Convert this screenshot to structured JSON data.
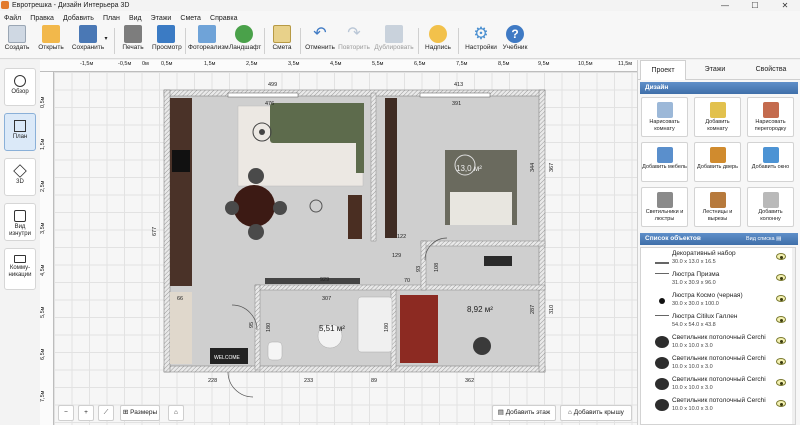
{
  "window": {
    "title": "Евротрешка - Дизайн Интерьера 3D",
    "minimize": "—",
    "maximize": "☐",
    "close": "✕"
  },
  "menu": [
    "Файл",
    "Правка",
    "Добавить",
    "План",
    "Вид",
    "Этажи",
    "Смета",
    "Справка"
  ],
  "toolbar": [
    {
      "label": "Создать",
      "icon": "new-file-icon",
      "color": "#cfd8e3"
    },
    {
      "label": "Открыть",
      "icon": "open-folder-icon",
      "color": "#f2b84b"
    },
    {
      "label": "Сохранить",
      "icon": "save-icon",
      "color": "#4a78b5"
    },
    {
      "label": "Печать",
      "icon": "printer-icon",
      "color": "#7d7d7d"
    },
    {
      "label": "Просмотр",
      "icon": "monitor-icon",
      "color": "#3b7bc4"
    },
    {
      "label": "Фотореализм",
      "icon": "photo-icon",
      "color": "#6fa3d8"
    },
    {
      "label": "Ландшафт",
      "icon": "tree-icon",
      "color": "#4aa14a"
    },
    {
      "label": "Смета",
      "icon": "estimate-icon",
      "color": "#e8d18a"
    },
    {
      "label": "Отменить",
      "icon": "undo-icon",
      "color": "#3f7ac4"
    },
    {
      "label": "Повторить",
      "icon": "redo-icon",
      "color": "#b9c6d6",
      "disabled": true
    },
    {
      "label": "Дублировать",
      "icon": "duplicate-icon",
      "color": "#c9d2dc",
      "disabled": true
    },
    {
      "label": "Надпись",
      "icon": "text-label-icon",
      "color": "#f2c14b"
    },
    {
      "label": "Настройки",
      "icon": "gear-icon",
      "color": "#4a8fd0"
    },
    {
      "label": "Учебник",
      "icon": "help-icon",
      "color": "#3f7ac4"
    }
  ],
  "leftnav": [
    {
      "label": "Обзор",
      "icon": "eye-icon"
    },
    {
      "label": "План",
      "icon": "plan-icon",
      "active": true
    },
    {
      "label": "3D",
      "icon": "cube-3d-icon"
    },
    {
      "label": "Вид изнутри",
      "icon": "interior-view-icon"
    },
    {
      "label": "Комму-никации",
      "icon": "utilities-icon"
    }
  ],
  "ruler": {
    "h": [
      "-1,5м",
      "-0,5м",
      "0м",
      "0,5м",
      "1,5м",
      "2,5м",
      "3,5м",
      "4,5м",
      "5,5м",
      "6,5м",
      "7,5м",
      "8,5м",
      "9,5м",
      "10,5м",
      "11,5м"
    ],
    "v": [
      "0,5м",
      "1,5м",
      "2,5м",
      "3,5м",
      "4,5м",
      "5,5м",
      "6,5м",
      "7,5м"
    ]
  },
  "plan": {
    "dims": {
      "top_left": "499",
      "top_right": "413",
      "inner_left": "476",
      "inner_right": "391",
      "left": "677",
      "right_upper": "344",
      "right_outer": "367",
      "d122": "122",
      "d129": "129",
      "d93": "93",
      "d70": "70",
      "d108": "108",
      "d929": "929",
      "d66": "66",
      "d307": "307",
      "d95": "95",
      "d180a": "180",
      "d180b": "180",
      "d287": "287",
      "d310": "310",
      "bottom": [
        "228",
        "233",
        "89",
        "362"
      ]
    },
    "areas": {
      "bath": "5,51 м²",
      "bedroom2": "8,92 м²",
      "bedroom": "13,0 м²"
    },
    "welcome": "WELCOME"
  },
  "bottombar": {
    "sizes": "Размеры",
    "add_floor": "Добавить этаж",
    "add_roof": "Добавить крышу"
  },
  "rightpanel": {
    "tabs": [
      "Проект",
      "Этажи",
      "Свойства"
    ],
    "design_header": "Дизайн",
    "design_buttons": [
      {
        "label": "Нарисовать комнату",
        "icon": "draw-room-icon",
        "color": "#9cb8d8"
      },
      {
        "label": "Добавить комнату",
        "icon": "add-room-icon",
        "color": "#e2c14d"
      },
      {
        "label": "Нарисовать перегородку",
        "icon": "brick-wall-icon",
        "color": "#c46b4e"
      },
      {
        "label": "Добавить мебель",
        "icon": "chair-icon",
        "color": "#5a8fcc"
      },
      {
        "label": "Добавить дверь",
        "icon": "door-icon",
        "color": "#d08b2e"
      },
      {
        "label": "Добавить окно",
        "icon": "window-icon",
        "color": "#4c93d4"
      },
      {
        "label": "Светильники и люстры",
        "icon": "chandelier-icon",
        "color": "#8a8a8a"
      },
      {
        "label": "Лестницы и вырезы",
        "icon": "stairs-icon",
        "color": "#b77a3c"
      },
      {
        "label": "Добавить колонну",
        "icon": "column-icon",
        "color": "#b9b9b9"
      }
    ],
    "objects_header": "Список объектов",
    "view_list": "Вид списка",
    "objects": [
      {
        "name": "Декоративный набор",
        "dims": "30.0 x 13.0 x 16.5",
        "icon": "decor-set-icon"
      },
      {
        "name": "Люстра Призма",
        "dims": "31.0 x 30.9 x 96.0",
        "icon": "chandelier-icon"
      },
      {
        "name": "Люстра Космо (черная)",
        "dims": "30.0 x 30.0 x 100.0",
        "icon": "pendant-lamp-icon"
      },
      {
        "name": "Люстра Citilux Галлен",
        "dims": "54.0 x 54.0 x 43.8",
        "icon": "chandelier-icon"
      },
      {
        "name": "Светильник потолочный Cerchi",
        "dims": "10.0 x 10.0 x 3.0",
        "icon": "ceiling-light-icon"
      },
      {
        "name": "Светильник потолочный Cerchi",
        "dims": "10.0 x 10.0 x 3.0",
        "icon": "ceiling-light-icon"
      },
      {
        "name": "Светильник потолочный Cerchi",
        "dims": "10.0 x 10.0 x 3.0",
        "icon": "ceiling-light-icon"
      },
      {
        "name": "Светильник потолочный Cerchi",
        "dims": "10.0 x 10.0 x 3.0",
        "icon": "ceiling-light-icon"
      }
    ]
  }
}
